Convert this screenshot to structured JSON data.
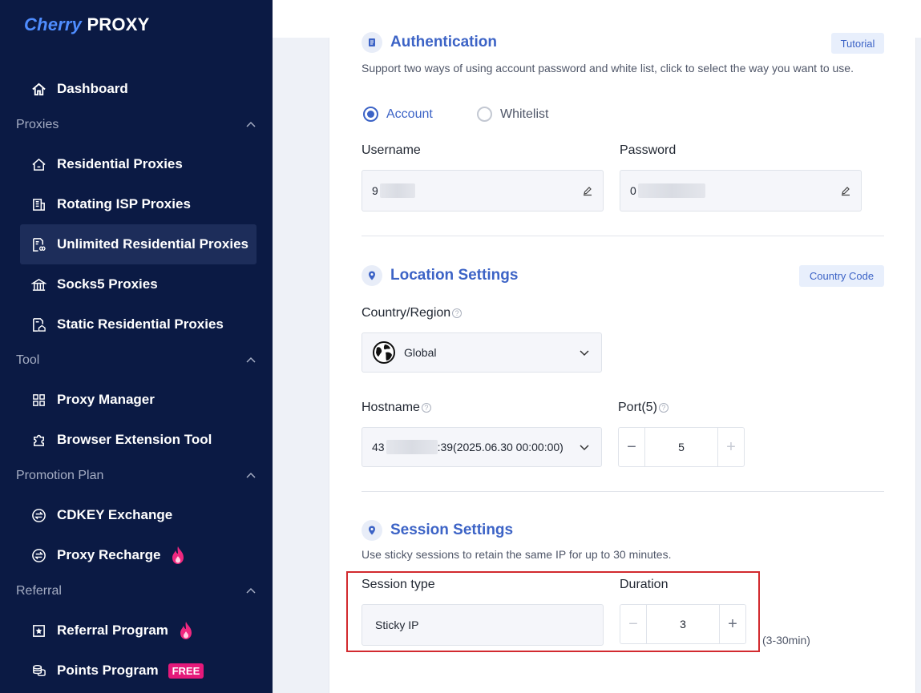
{
  "brand": {
    "logo_part1": "Cherry",
    "logo_part2": "PROXY"
  },
  "sidebar": {
    "dashboard": "Dashboard",
    "proxies_section": "Proxies",
    "proxies": [
      "Residential Proxies",
      "Rotating ISP Proxies",
      "Unlimited Residential Proxies",
      "Socks5 Proxies",
      "Static Residential Proxies"
    ],
    "tool_section": "Tool",
    "tools": [
      "Proxy Manager",
      "Browser Extension Tool"
    ],
    "promotion_section": "Promotion Plan",
    "promotion": [
      "CDKEY Exchange",
      "Proxy Recharge"
    ],
    "referral_section": "Referral",
    "referral": [
      "Referral Program",
      "Points Program"
    ],
    "free_badge": "FREE"
  },
  "auth": {
    "title": "Authentication",
    "tutorial": "Tutorial",
    "desc": "Support two ways of using account password and white list, click to select the way you want to use.",
    "option_account": "Account",
    "option_whitelist": "Whitelist",
    "username_label": "Username",
    "username_value": "9",
    "password_label": "Password",
    "password_value": "0"
  },
  "location": {
    "title": "Location Settings",
    "country_code": "Country Code",
    "country_label": "Country/Region",
    "country_value": "Global",
    "hostname_label": "Hostname",
    "hostname_prefix": "43",
    "hostname_suffix": ":39(2025.06.30 00:00:00)",
    "port_label": "Port(5)",
    "port_value": "5"
  },
  "session": {
    "title": "Session Settings",
    "desc": "Use sticky sessions to retain the same IP for up to 30 minutes.",
    "type_label": "Session type",
    "type_value": "Sticky IP",
    "duration_label": "Duration",
    "duration_value": "3",
    "duration_range": "(3-30min)"
  },
  "colors": {
    "sidebar_bg": "#0b1a44",
    "accent": "#3c63c6",
    "highlight": "#d22a2f",
    "badge": "#e5197a"
  }
}
